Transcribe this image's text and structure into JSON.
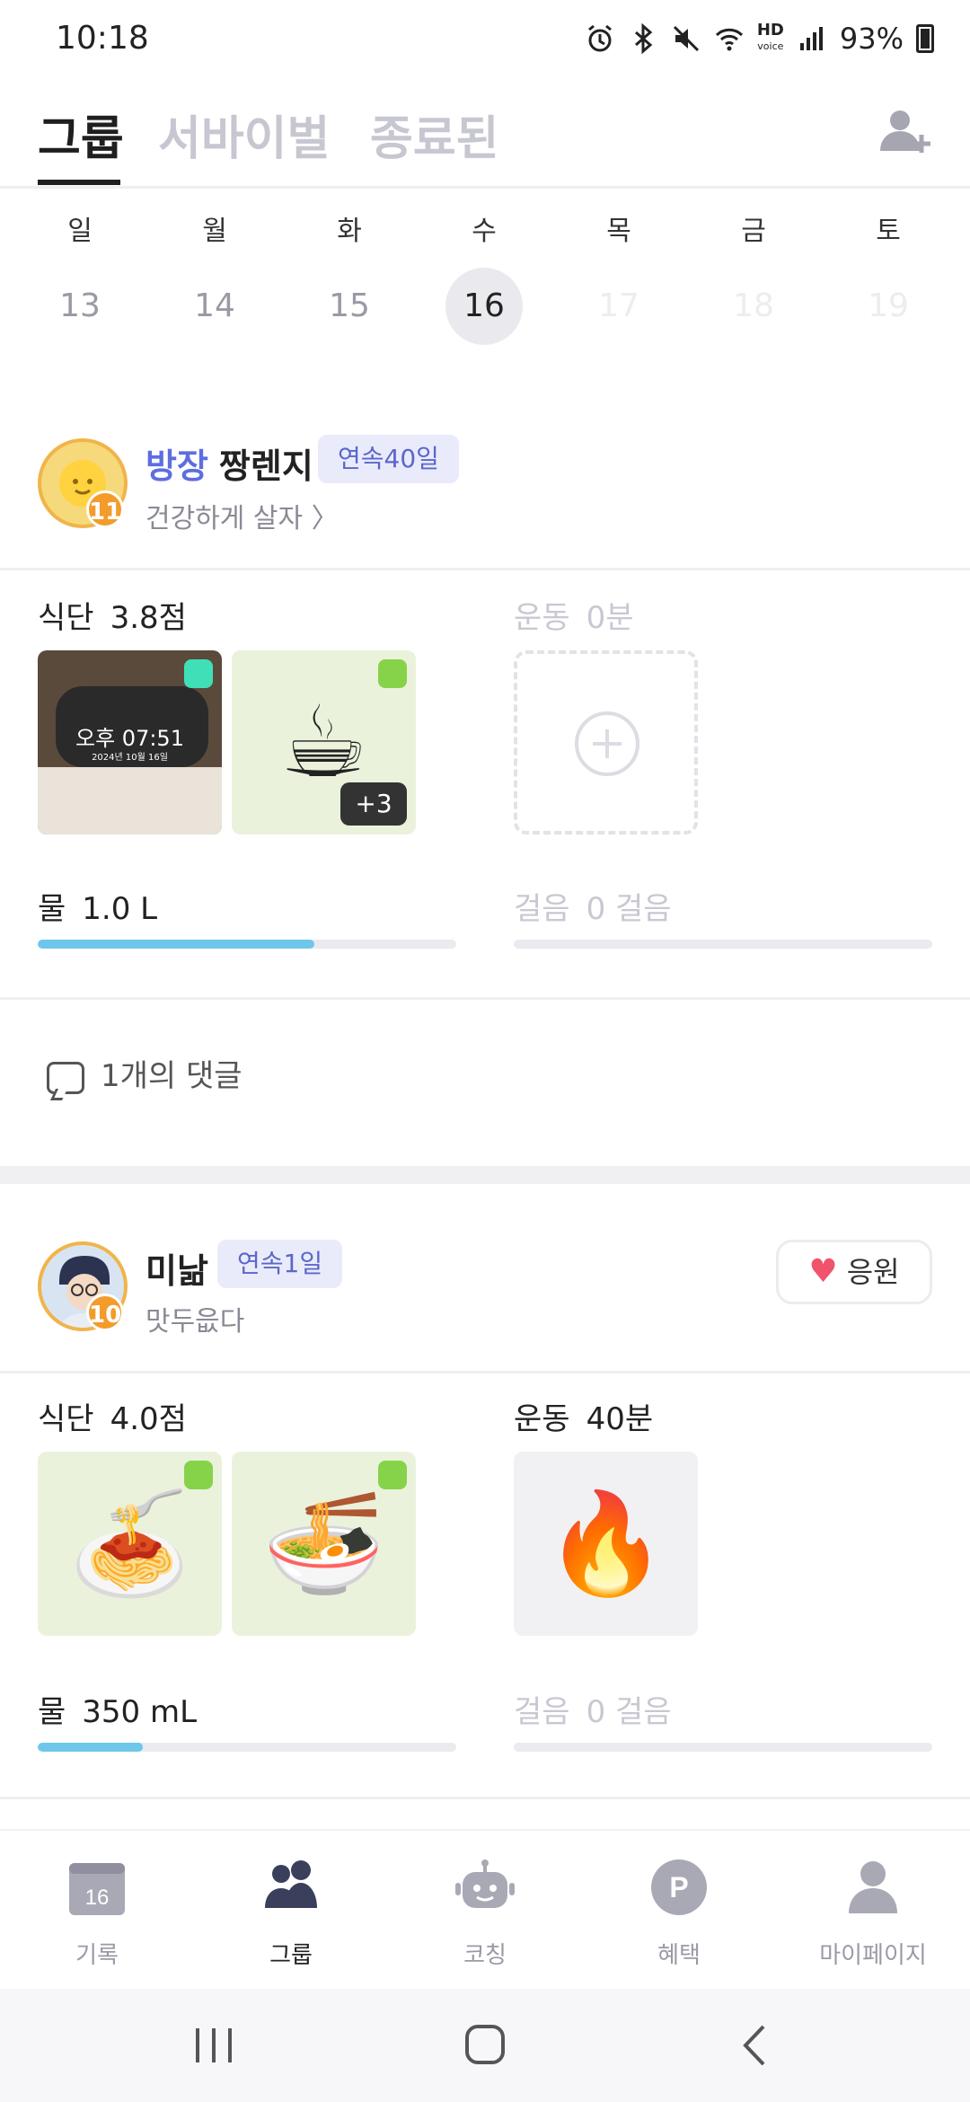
{
  "status_bar": {
    "time": "10:18",
    "battery": "93%",
    "hd_label": "HD"
  },
  "tabs": [
    {
      "label": "그룹",
      "active": true
    },
    {
      "label": "서바이벌",
      "active": false
    },
    {
      "label": "종료된",
      "active": false
    }
  ],
  "calendar": [
    {
      "day": "일",
      "date": "13"
    },
    {
      "day": "월",
      "date": "14"
    },
    {
      "day": "화",
      "date": "15"
    },
    {
      "day": "수",
      "date": "16",
      "today": true
    },
    {
      "day": "목",
      "date": "17"
    },
    {
      "day": "금",
      "date": "18"
    },
    {
      "day": "토",
      "date": "19"
    }
  ],
  "members": [
    {
      "role": "방장",
      "name": "짱렌지",
      "level": "11",
      "streak": "연속40일",
      "status": "건강하게 살자",
      "diet_label": "식단",
      "diet_score": "3.8점",
      "exercise_label": "운동",
      "exercise_value": "0분",
      "photo_overlay_time": "오후 07:51",
      "photo_overlay_date": "2024년 10월 16일",
      "extra_count": "+3",
      "water_label": "물",
      "water_value": "1.0 L",
      "water_progress": 0.66,
      "steps_label": "걸음",
      "steps_value": "0 걸음",
      "steps_progress": 0,
      "comments": "1개의 댓글"
    },
    {
      "name": "미낢",
      "level": "10",
      "streak": "연속1일",
      "status": "맛두읎다",
      "cheer_label": "응원",
      "diet_label": "식단",
      "diet_score": "4.0점",
      "exercise_label": "운동",
      "exercise_value": "40분",
      "water_label": "물",
      "water_value": "350 mL",
      "water_progress": 0.25,
      "steps_label": "걸음",
      "steps_value": "0 걸음",
      "steps_progress": 0
    }
  ],
  "bottom_nav": [
    {
      "label": "기록",
      "icon": "calendar-icon",
      "badge": "16"
    },
    {
      "label": "그룹",
      "icon": "group-icon",
      "active": true
    },
    {
      "label": "코칭",
      "icon": "robot-icon"
    },
    {
      "label": "혜택",
      "icon": "points-icon",
      "badge": "P"
    },
    {
      "label": "마이페이지",
      "icon": "person-icon"
    }
  ]
}
